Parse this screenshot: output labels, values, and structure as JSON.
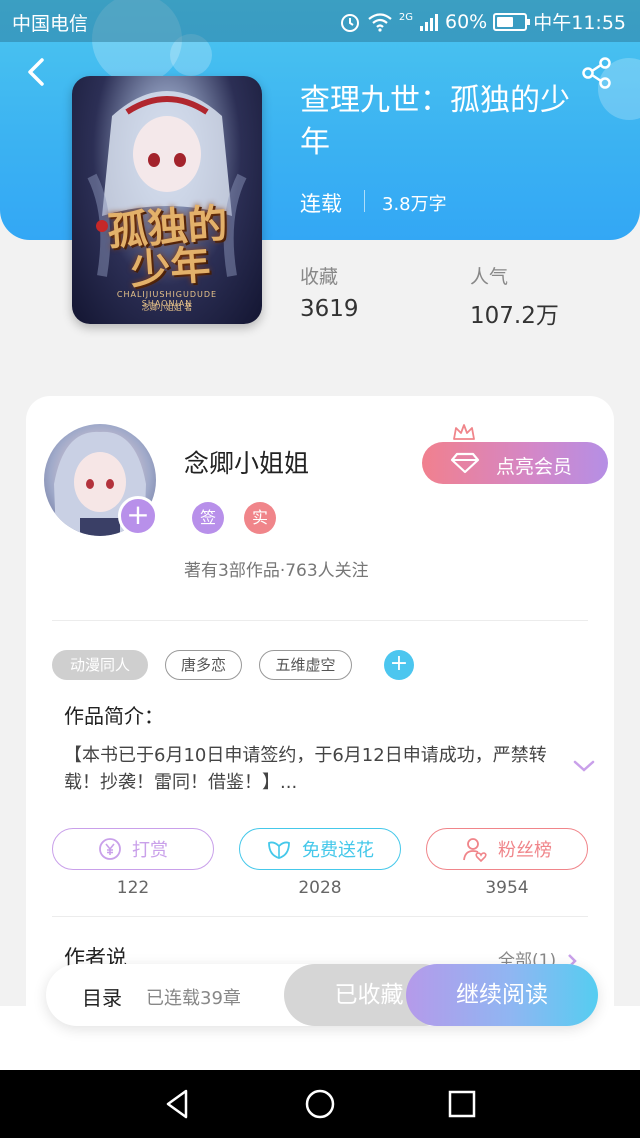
{
  "status_bar": {
    "carrier": "中国电信",
    "network": "2G",
    "battery": "60%",
    "battery_level": 0.6,
    "time": "中午11:55"
  },
  "book": {
    "title": "查理九世：孤独的少年",
    "status": "连载",
    "word_count": "3.8万字",
    "cover_title": "孤独的少年",
    "cover_subtitle": "CHALIJIUSHIGUDUDE SHAONIAN",
    "cover_author": "念卿小姐姐 著"
  },
  "stats": {
    "favorites_label": "收藏",
    "favorites_value": "3619",
    "popularity_label": "人气",
    "popularity_value": "107.2万"
  },
  "author": {
    "name": "念卿小姐姐",
    "badge_sign": "签",
    "badge_real": "实",
    "info": "著有3部作品·763人关注",
    "follow_plus": "+"
  },
  "vip": {
    "label": "点亮会员"
  },
  "tags": [
    "动漫同人",
    "唐多恋",
    "五维虚空"
  ],
  "tag_add": "+",
  "intro": {
    "title": "作品简介：",
    "text": "【本书已于6月10日申请签约，于6月12日申请成功，严禁转载！抄袭！雷同！借鉴！】..."
  },
  "actions": [
    {
      "label": "打赏",
      "count": "122",
      "color": "#c9a0ea"
    },
    {
      "label": "免费送花",
      "count": "2028",
      "color": "#45c8ea"
    },
    {
      "label": "粉丝榜",
      "count": "3954",
      "color": "#f0858a"
    }
  ],
  "author_say": {
    "title": "作者说",
    "all_link": "全部(1)"
  },
  "bottom_bar": {
    "catalog": "目录",
    "serial_info": "已连载39章",
    "collected": "已收藏",
    "continue_reading": "继续阅读"
  },
  "icons": {
    "back": "chevron-left-icon",
    "share": "share-icon",
    "vip": "diamond-icon",
    "crown": "crown-icon",
    "reward": "yen-icon",
    "flower": "flower-icon",
    "fans": "user-heart-icon",
    "expand": "chevron-down-icon",
    "nav_back": "triangle-back-icon",
    "nav_home": "circle-home-icon",
    "nav_recent": "square-recent-icon"
  }
}
